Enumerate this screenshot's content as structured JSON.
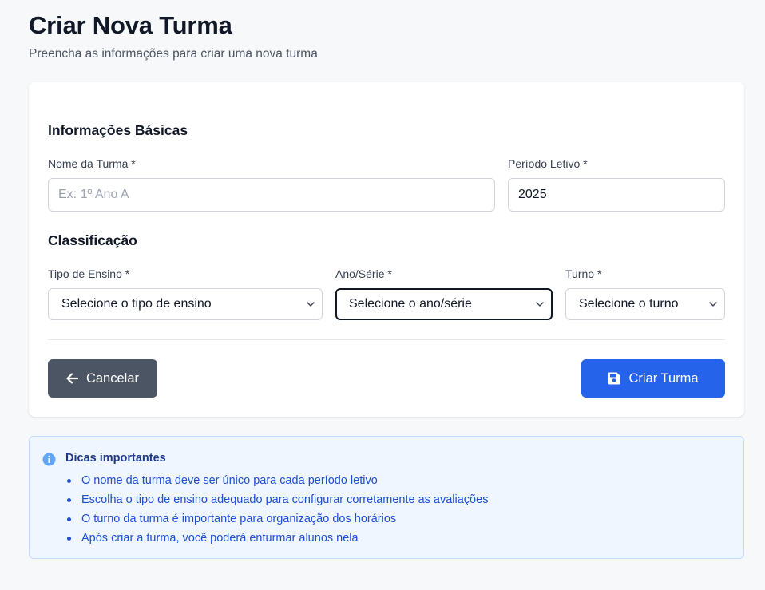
{
  "header": {
    "title": "Criar Nova Turma",
    "subtitle": "Preencha as informações para criar uma nova turma"
  },
  "form": {
    "basic_section_title": "Informações Básicas",
    "nome_label": "Nome da Turma *",
    "nome_placeholder": "Ex: 1º Ano A",
    "nome_value": "",
    "periodo_label": "Período Letivo *",
    "periodo_value": "2025",
    "class_section_title": "Classificação",
    "tipo_label": "Tipo de Ensino *",
    "tipo_selected": "Selecione o tipo de ensino",
    "ano_label": "Ano/Série *",
    "ano_selected": "Selecione o ano/série",
    "turno_label": "Turno *",
    "turno_selected": "Selecione o turno"
  },
  "actions": {
    "cancel_label": "Cancelar",
    "cancel_icon": "arrow-left-icon",
    "create_label": "Criar Turma",
    "create_icon": "save-icon"
  },
  "tips": {
    "icon": "info-icon",
    "title": "Dicas importantes",
    "items": [
      "O nome da turma deve ser único para cada período letivo",
      "Escolha o tipo de ensino adequado para configurar corretamente as avaliações",
      "O turno da turma é importante para organização dos horários",
      "Após criar a turma, você poderá enturmar alunos nela"
    ]
  },
  "colors": {
    "primary": "#2563eb",
    "secondary": "#4b5563",
    "tips_bg": "#eff6ff",
    "tips_text": "#1d4ed8"
  }
}
